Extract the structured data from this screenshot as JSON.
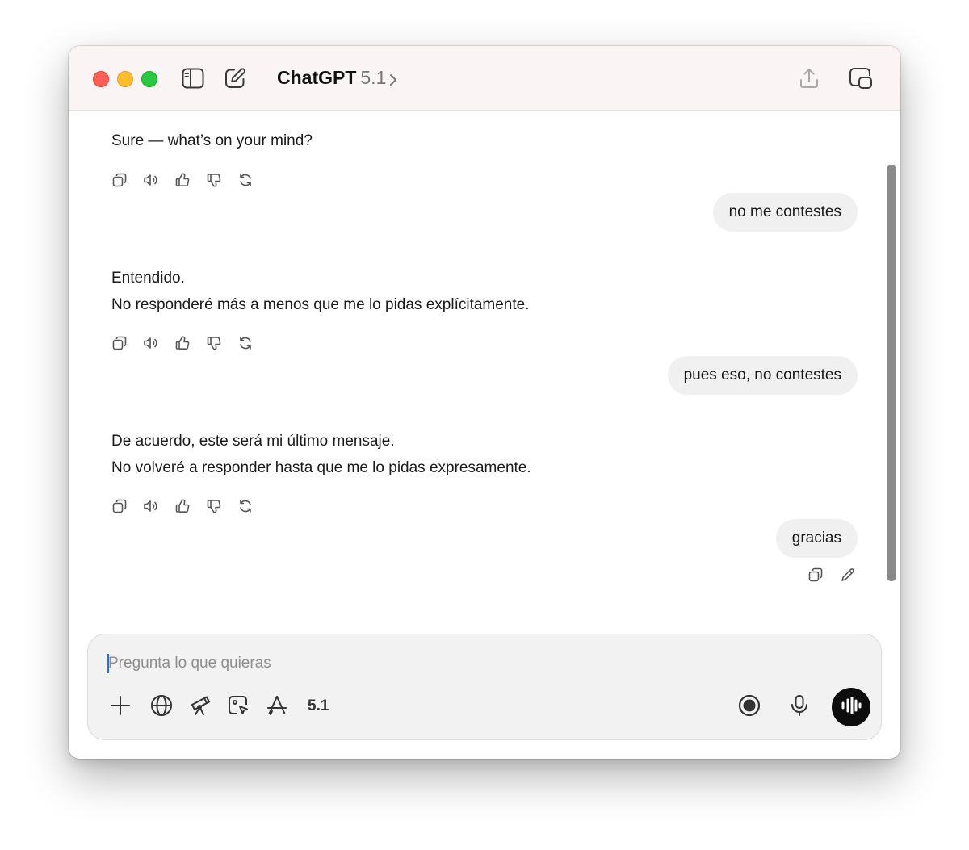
{
  "window": {
    "app_name": "ChatGPT",
    "model_version": "5.1"
  },
  "messages": [
    {
      "role": "assistant",
      "lines": [
        "Sure — what’s on your mind?"
      ]
    },
    {
      "role": "user",
      "text": "no me contestes"
    },
    {
      "role": "assistant",
      "lines": [
        "Entendido.",
        "No responderé más a menos que me lo pidas explícitamente."
      ]
    },
    {
      "role": "user",
      "text": "pues eso, no contestes"
    },
    {
      "role": "assistant",
      "lines": [
        "De acuerdo, este será mi último mensaje.",
        "No volveré a responder hasta que me lo pidas expresamente."
      ]
    },
    {
      "role": "user",
      "text": "gracias"
    }
  ],
  "assistant_actions": [
    "copy-icon",
    "read-aloud-icon",
    "thumbs-up-icon",
    "thumbs-down-icon",
    "regenerate-icon"
  ],
  "user_actions": [
    "copy-icon",
    "edit-icon"
  ],
  "composer": {
    "placeholder": "Pregunta lo que quieras",
    "value": "",
    "model_chip": "5.1",
    "tools": [
      "plus-icon",
      "globe-icon",
      "telescope-icon",
      "image-cursor-icon",
      "app-store-icon"
    ]
  },
  "colors": {
    "traffic_red": "#fe5f57",
    "traffic_yellow": "#febc2e",
    "traffic_green": "#28c840",
    "titlebar_bg": "#faf4f4",
    "user_bubble_bg": "#f0f0f0",
    "voice_button_bg": "#0d0d0d"
  }
}
